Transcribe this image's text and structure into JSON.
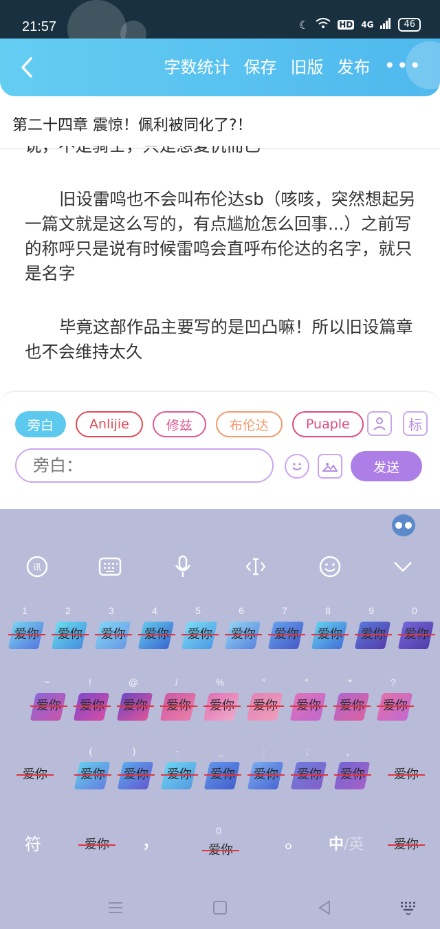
{
  "status": {
    "time": "21:57",
    "hd": "HD",
    "network": "4G",
    "battery": "46"
  },
  "toolbar": {
    "back_label": "‹",
    "actions": [
      "字数统计",
      "保存",
      "旧版",
      "发布"
    ],
    "more_label": "•••"
  },
  "chapter_title": "第二十四章 震惊！佩利被同化了?！",
  "content": {
    "cut_line": "说，不是骑士，只是想复仇而已",
    "para1": "旧设雷鸣也不会叫布伦达sb（咳咳，突然想起另一篇文就是这么写的，有点尴尬怎么回事...）之前写的称呼只是说有时候雷鸣会直呼布伦达的名字，就只是名字",
    "para2": "毕竟这部作品主要写的是凹凸嘛！所以旧设篇章也不会维持太久"
  },
  "roles": {
    "items": [
      "旁白",
      "Anlijie",
      "修兹",
      "布伦达",
      "Puaple"
    ],
    "selected": "旁白",
    "tag_icon_label": "标"
  },
  "composer": {
    "placeholder": "旁白：",
    "send_label": "发送"
  },
  "keyboard": {
    "key_text": "爱你",
    "row1_hints": [
      "1",
      "2",
      "3",
      "4",
      "5",
      "6",
      "7",
      "8",
      "9",
      "0"
    ],
    "row2_hints": [
      "~",
      "!",
      "@",
      "/",
      "%",
      "\"",
      "\"",
      "*",
      "?"
    ],
    "row3_hints": [
      "(",
      ")",
      "-",
      "_",
      ":",
      ";",
      "、"
    ],
    "symbol_label": "符",
    "comma_label": "，",
    "period_label": "。",
    "lang_primary": "中",
    "lang_secondary": "/英",
    "space_hint": "0"
  },
  "colors": {
    "accent": "#5dc9ee",
    "send": "#ad7fe6",
    "keyboard_bg": "#b8bcd9"
  }
}
